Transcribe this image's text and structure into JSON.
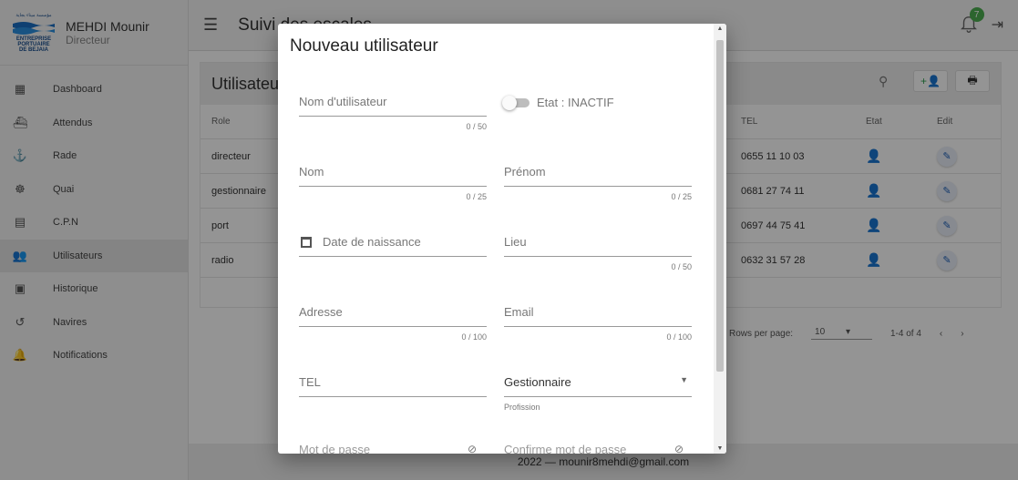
{
  "sidebar": {
    "logo": {
      "top_text": "مؤسسة ميناء بجاية",
      "line1": "ENTREPRISE",
      "line2": "PORTUAIRE",
      "line3": "DE BEJAIA"
    },
    "user_name": "MEHDI Mounir",
    "user_role": "Directeur",
    "items": [
      {
        "label": "Dashboard",
        "icon": "dashboard-icon"
      },
      {
        "label": "Attendus",
        "icon": "ship-icon"
      },
      {
        "label": "Rade",
        "icon": "anchor-icon"
      },
      {
        "label": "Quai",
        "icon": "helm-icon"
      },
      {
        "label": "C.P.N",
        "icon": "clipboard-icon"
      },
      {
        "label": "Utilisateurs",
        "icon": "users-icon"
      },
      {
        "label": "Historique",
        "icon": "calendar-clock-icon"
      },
      {
        "label": "Navires",
        "icon": "history-icon"
      },
      {
        "label": "Notifications",
        "icon": "bell-settings-icon"
      }
    ],
    "active_index": 5
  },
  "header": {
    "title": "Suivi des escales",
    "notification_count": "7"
  },
  "card": {
    "title": "Utilisateurs",
    "columns": {
      "role": "Role",
      "tel": "TEL",
      "etat": "Etat",
      "edit": "Edit"
    },
    "rows": [
      {
        "role": "directeur",
        "tel": "0655 11 10 03",
        "etat": "active"
      },
      {
        "role": "gestionnaire",
        "tel": "0681 27 74 11",
        "etat": "active"
      },
      {
        "role": "port",
        "tel": "0697 44 75 41",
        "etat": "inactive"
      },
      {
        "role": "radio",
        "tel": "0632 31 57 28",
        "etat": "active"
      }
    ],
    "pagination": {
      "rows_per_page_label": "Rows per page:",
      "rows_per_page": "10",
      "range": "1-4 of 4"
    }
  },
  "footer": {
    "text": "2022 — mounir8mehdi@gmail.com"
  },
  "dialog": {
    "title": "Nouveau utilisateur",
    "username": {
      "label": "Nom d'utilisateur",
      "counter": "0 / 50"
    },
    "etat_toggle": {
      "label": "Etat : INACTIF"
    },
    "nom": {
      "label": "Nom",
      "counter": "0 / 25"
    },
    "prenom": {
      "label": "Prénom",
      "counter": "0 / 25"
    },
    "date_naissance": {
      "label": "Date de naissance"
    },
    "lieu": {
      "label": "Lieu",
      "counter": "0 / 50"
    },
    "adresse": {
      "label": "Adresse",
      "counter": "0 / 100"
    },
    "email": {
      "label": "Email",
      "counter": "0 / 100"
    },
    "tel": {
      "label": "TEL"
    },
    "profession": {
      "value": "Gestionnaire",
      "hint": "Profission"
    },
    "mot_de_passe": {
      "label": "Mot de passe"
    },
    "confirme": {
      "label": "Confirme mot de passe"
    }
  }
}
